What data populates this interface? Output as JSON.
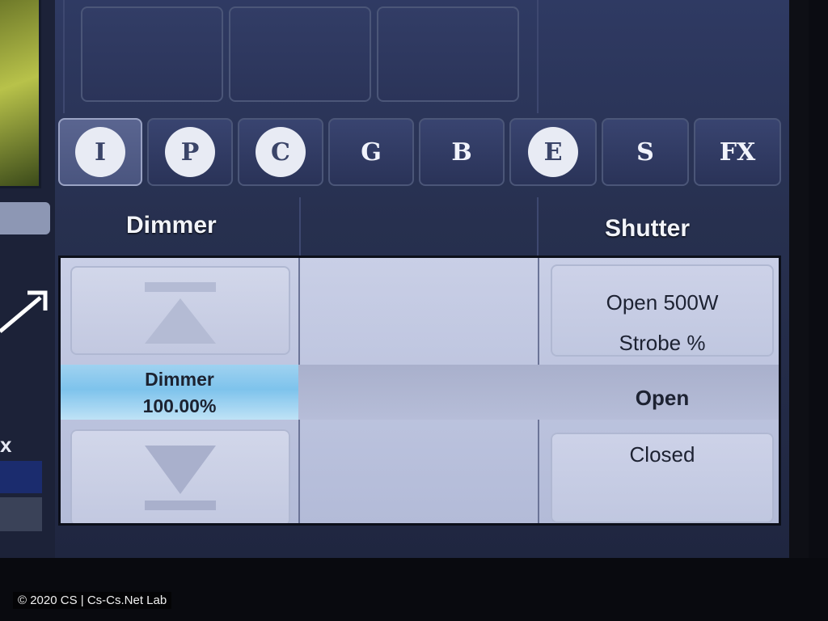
{
  "tabs": [
    {
      "label": "I",
      "style": "circle",
      "active": true
    },
    {
      "label": "P",
      "style": "circle",
      "active": false
    },
    {
      "label": "C",
      "style": "circle",
      "active": false
    },
    {
      "label": "G",
      "style": "plain",
      "active": false
    },
    {
      "label": "B",
      "style": "plain",
      "active": false
    },
    {
      "label": "E",
      "style": "circle",
      "active": false
    },
    {
      "label": "S",
      "style": "plain",
      "active": false
    },
    {
      "label": "FX",
      "style": "plain",
      "active": false
    }
  ],
  "columns": {
    "dimmer_label": "Dimmer",
    "shutter_label": "Shutter"
  },
  "dimmer": {
    "name": "Dimmer",
    "value": "100.00%"
  },
  "shutter": {
    "items": [
      "Open 500W",
      "Strobe %",
      "Open",
      "Closed"
    ],
    "selected": "Open"
  },
  "left": {
    "glyph": "x"
  },
  "footer": {
    "copyright": "© 2020 CS | Cs-Cs.Net Lab"
  }
}
